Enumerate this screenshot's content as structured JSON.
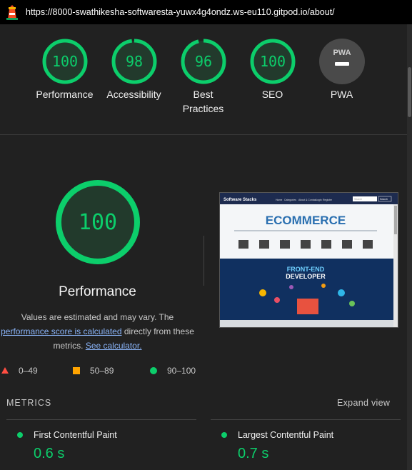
{
  "browser": {
    "url": "https://8000-swathikesha-softwaresta-yuwx4g4ondz.ws-eu110.gitpod.io/about/"
  },
  "colors": {
    "pass": "#0cce6b",
    "average": "#ffa400",
    "fail": "#ff4e42",
    "background": "#212121"
  },
  "categories": [
    {
      "label": "Performance",
      "score": "100",
      "level": 1.0
    },
    {
      "label": "Accessibility",
      "score": "98",
      "level": 0.98
    },
    {
      "label": "Best Practices",
      "score": "96",
      "level": 0.96
    },
    {
      "label": "SEO",
      "score": "100",
      "level": 1.0
    },
    {
      "label": "PWA",
      "badge": "PWA"
    }
  ],
  "performance": {
    "score": "100",
    "level": 1.0,
    "title": "Performance",
    "desc_prefix": "Values are estimated and may vary. The",
    "score_link": "performance score is calculated",
    "desc_middle": "directly from these metrics.",
    "calculator_link": "See calculator."
  },
  "legend": {
    "fail": "0–49",
    "average": "50–89",
    "pass": "90–100"
  },
  "screenshot": {
    "site_name": "Software Stacks",
    "nav": [
      "Home",
      "Categories",
      "About & Contact",
      "Login",
      "Register"
    ],
    "search_placeholder": "Search",
    "search_button": "Search",
    "banner1": "ECOMMERCE",
    "banner2_line1": "FRONT-END",
    "banner2_line2": "DEVELOPER"
  },
  "metrics": {
    "heading": "METRICS",
    "expand_label": "Expand view",
    "items": [
      {
        "name": "First Contentful Paint",
        "value": "0.6 s"
      },
      {
        "name": "Largest Contentful Paint",
        "value": "0.7 s"
      }
    ]
  }
}
